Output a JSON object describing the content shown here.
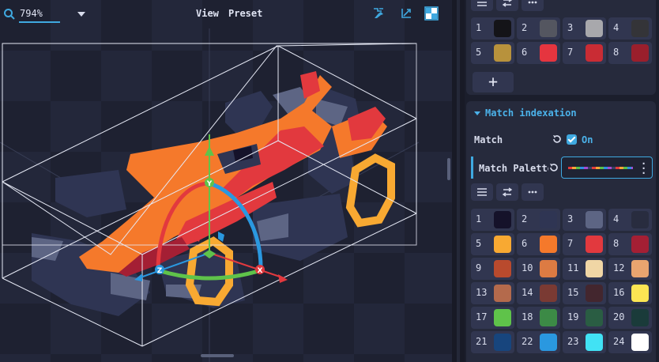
{
  "toolbar": {
    "zoom_value": "794%",
    "view_label": "View",
    "preset_label": "Preset"
  },
  "axes": {
    "y": "Y",
    "z": "Z",
    "x": "X"
  },
  "palette_top": {
    "colors": [
      {
        "index": "1",
        "color": "#141418"
      },
      {
        "index": "2",
        "color": "#545660"
      },
      {
        "index": "3",
        "color": "#a8a8ac"
      },
      {
        "index": "4",
        "color": "#343438"
      },
      {
        "index": "5",
        "color": "#b8923c"
      },
      {
        "index": "6",
        "color": "#e5353f"
      },
      {
        "index": "7",
        "color": "#c92c34"
      },
      {
        "index": "8",
        "color": "#9a1f2c"
      }
    ],
    "add_label": "+"
  },
  "match_indexation": {
    "title": "Match indexation",
    "match_label": "Match",
    "match_state": "On",
    "palette_label": "Match Palette",
    "colors": [
      {
        "index": "1",
        "color": "#15122a"
      },
      {
        "index": "2",
        "color": "#2f3553"
      },
      {
        "index": "3",
        "color": "#5d6584"
      },
      {
        "index": "4",
        "color": "#282c3f"
      },
      {
        "index": "5",
        "color": "#f8a932"
      },
      {
        "index": "6",
        "color": "#f5792b"
      },
      {
        "index": "7",
        "color": "#e2393e"
      },
      {
        "index": "8",
        "color": "#a41f34"
      },
      {
        "index": "9",
        "color": "#b94a2d"
      },
      {
        "index": "10",
        "color": "#dd7b43"
      },
      {
        "index": "11",
        "color": "#f0d6a5"
      },
      {
        "index": "12",
        "color": "#e9a46f"
      },
      {
        "index": "13",
        "color": "#b46a4c"
      },
      {
        "index": "14",
        "color": "#7a3a33"
      },
      {
        "index": "15",
        "color": "#43262e"
      },
      {
        "index": "16",
        "color": "#fce553"
      },
      {
        "index": "17",
        "color": "#5fc34a"
      },
      {
        "index": "18",
        "color": "#3c8a46"
      },
      {
        "index": "19",
        "color": "#2a5d43"
      },
      {
        "index": "20",
        "color": "#1a3b3a"
      },
      {
        "index": "21",
        "color": "#17457d"
      },
      {
        "index": "22",
        "color": "#2a98e0"
      },
      {
        "index": "23",
        "color": "#41e2f4"
      },
      {
        "index": "24",
        "color": "#ffffff"
      }
    ]
  }
}
